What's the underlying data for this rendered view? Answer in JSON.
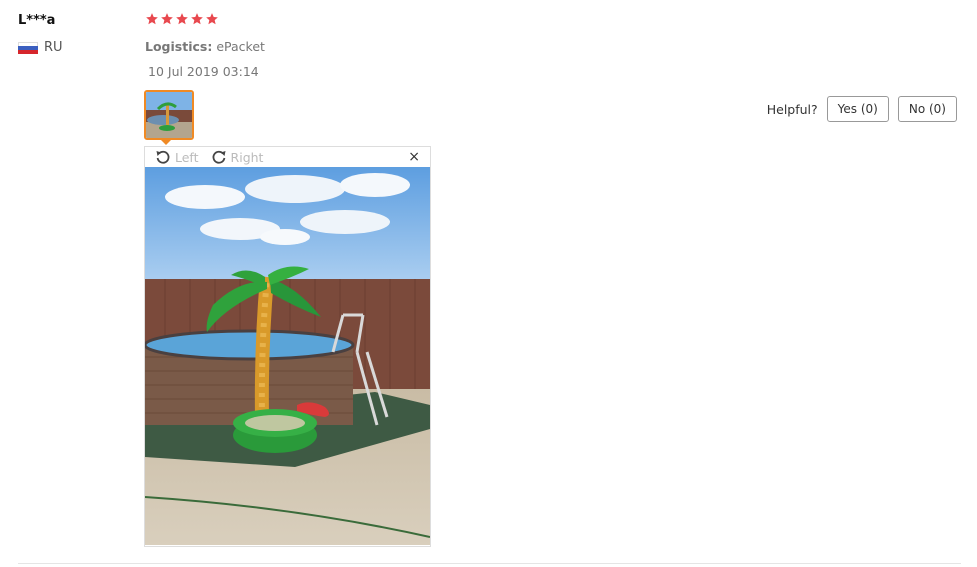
{
  "review": {
    "user_name": "L***a",
    "country_code": "RU",
    "rating": 5,
    "logistics_label": "Logistics:",
    "logistics_value": "ePacket",
    "date": "10 Jul 2019 03:14"
  },
  "helpful": {
    "label": "Helpful?",
    "yes_label": "Yes (0)",
    "no_label": "No (0)"
  },
  "viewer": {
    "rotate_left_label": "Left",
    "rotate_right_label": "Right",
    "close_glyph": "×"
  },
  "colors": {
    "star": "#e8484e",
    "accent_border": "#f08a24"
  },
  "icons": [
    "flag-icon",
    "star-icon",
    "rotate-left-icon",
    "rotate-right-icon",
    "close-icon"
  ]
}
